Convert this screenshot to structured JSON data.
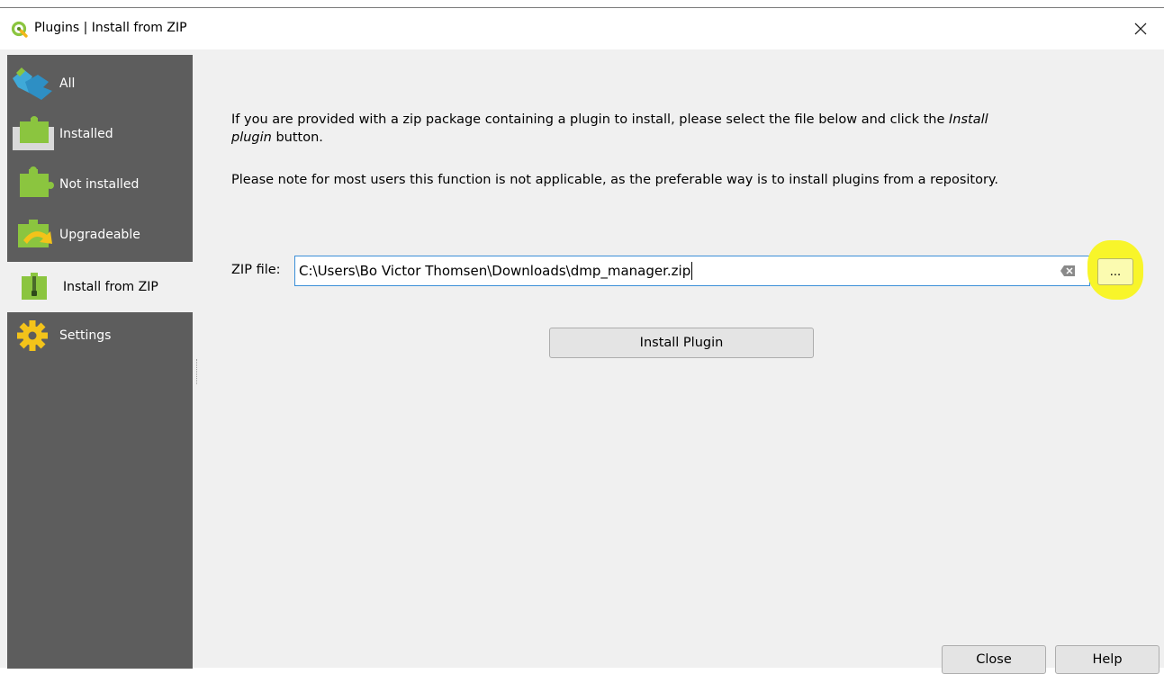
{
  "window": {
    "title": "Plugins | Install from ZIP",
    "close_glyph": "✕"
  },
  "sidebar": {
    "items": [
      {
        "label": "All",
        "icon": "puzzle-all-icon"
      },
      {
        "label": "Installed",
        "icon": "puzzle-installed-icon"
      },
      {
        "label": "Not installed",
        "icon": "puzzle-not-installed-icon"
      },
      {
        "label": "Upgradeable",
        "icon": "puzzle-upgrade-icon"
      },
      {
        "label": "Install from ZIP",
        "icon": "zip-icon",
        "active": true
      },
      {
        "label": "Settings",
        "icon": "gear-icon"
      }
    ]
  },
  "main": {
    "intro_text": "If you are provided with a zip package containing a plugin to install, please select the file below and click the ",
    "intro_emph1": "Install",
    "intro_emph2": "plugin",
    "intro_tail": " button.",
    "note_text": "Please note for most users this function is not applicable, as the preferable way is to install plugins from a repository.",
    "zip_label": "ZIP file:",
    "zip_value": "C:\\Users\\Bo Victor Thomsen\\Downloads\\dmp_manager.zip",
    "browse_label": "...",
    "install_label": "Install Plugin"
  },
  "footer": {
    "close_label": "Close",
    "help_label": "Help"
  },
  "colors": {
    "sidebar_bg": "#5d5d5d",
    "highlight": "#f8f52a",
    "input_border": "#3b8fd8",
    "qgis_green": "#8bc53f"
  }
}
